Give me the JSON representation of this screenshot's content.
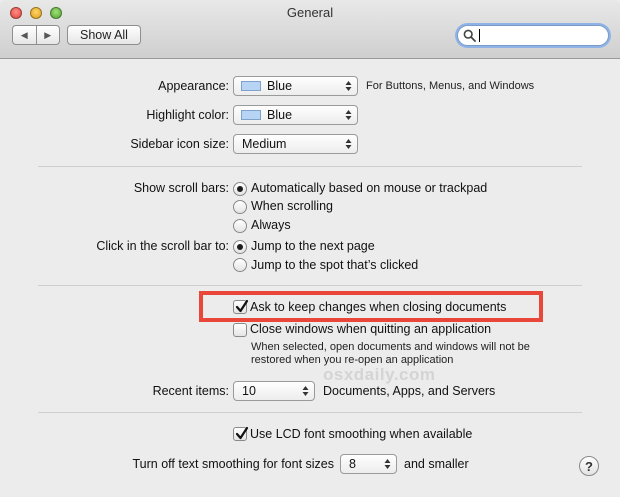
{
  "window": {
    "title": "General"
  },
  "toolbar": {
    "back_glyph": "◀",
    "forward_glyph": "▶",
    "show_all_label": "Show All",
    "search_value": ""
  },
  "appearance": {
    "label": "Appearance:",
    "value": "Blue",
    "note": "For Buttons, Menus, and Windows"
  },
  "highlight": {
    "label": "Highlight color:",
    "value": "Blue"
  },
  "sidebar_icon": {
    "label": "Sidebar icon size:",
    "value": "Medium"
  },
  "scroll_bars": {
    "label": "Show scroll bars:",
    "options": [
      "Automatically based on mouse or trackpad",
      "When scrolling",
      "Always"
    ],
    "selected": 0
  },
  "click_scroll": {
    "label": "Click in the scroll bar to:",
    "options": [
      "Jump to the next page",
      "Jump to the spot that’s clicked"
    ],
    "selected": 0
  },
  "ask_keep_changes": {
    "label": "Ask to keep changes when closing documents",
    "checked": true
  },
  "close_windows": {
    "label": "Close windows when quitting an application",
    "checked": false,
    "note_line1": "When selected, open documents and windows will not be",
    "note_line2": "restored when you re-open an application"
  },
  "watermark": "osxdaily.com",
  "recent_items": {
    "label": "Recent items:",
    "value": "10",
    "suffix": "Documents, Apps, and Servers"
  },
  "lcd_smoothing": {
    "label": "Use LCD font smoothing when available",
    "checked": true
  },
  "text_smoothing": {
    "label": "Turn off text smoothing for font sizes",
    "value": "8",
    "suffix": "and smaller"
  },
  "help_glyph": "?",
  "colors": {
    "highlight_border": "#e8473a",
    "swatch_blue": "#b8d4f4"
  }
}
